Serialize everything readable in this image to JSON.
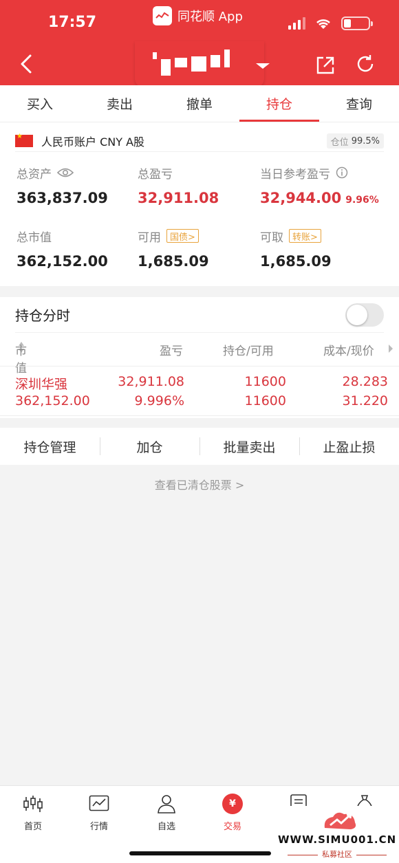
{
  "status_bar": {
    "time": "17:57",
    "app_name": "同花顺 App"
  },
  "header": {
    "account_masked": true
  },
  "tabs": [
    {
      "label": "买入"
    },
    {
      "label": "卖出"
    },
    {
      "label": "撤单"
    },
    {
      "label": "持仓",
      "active": true
    },
    {
      "label": "查询"
    }
  ],
  "account": {
    "name": "人民币账户 CNY A股",
    "position_label": "仓位",
    "position_value": "99.5%",
    "total_assets_label": "总资产",
    "total_assets": "363,837.09",
    "total_pnl_label": "总盈亏",
    "total_pnl": "32,911.08",
    "daily_pnl_label": "当日参考盈亏",
    "daily_pnl": "32,944.00",
    "daily_pnl_pct": "9.96%",
    "market_value_label": "总市值",
    "market_value": "362,152.00",
    "available_label": "可用",
    "available_tag": "国债>",
    "available": "1,685.09",
    "withdrawable_label": "可取",
    "withdrawable_tag": "转账>",
    "withdrawable": "1,685.09"
  },
  "positions": {
    "title": "持仓分时",
    "toggle_on": false,
    "columns": {
      "market_value": "市值",
      "pnl": "盈亏",
      "holding": "持仓/可用",
      "cost": "成本/现价"
    },
    "rows": [
      {
        "name": "深圳华强",
        "market_value": "362,152.00",
        "pnl": "32,911.08",
        "pnl_pct": "9.996%",
        "holding": "11600",
        "available": "11600",
        "cost": "28.283",
        "price": "31.220"
      }
    ]
  },
  "actions": [
    {
      "label": "持仓管理"
    },
    {
      "label": "加仓"
    },
    {
      "label": "批量卖出"
    },
    {
      "label": "止盈止损"
    }
  ],
  "cleared_link": "查看已清仓股票 >",
  "bottom_nav": [
    {
      "label": "首页",
      "icon": "candlestick-icon"
    },
    {
      "label": "行情",
      "icon": "chart-icon"
    },
    {
      "label": "自选",
      "icon": "person-icon"
    },
    {
      "label": "交易",
      "icon": "yuan-icon",
      "active": true
    }
  ],
  "watermark": {
    "url": "WWW.SIMU001.CN",
    "subtitle": "私募社区"
  },
  "colors": {
    "brand_red": "#e8393b",
    "gain_red": "#d9363e",
    "tag_orange": "#e8a33c"
  }
}
